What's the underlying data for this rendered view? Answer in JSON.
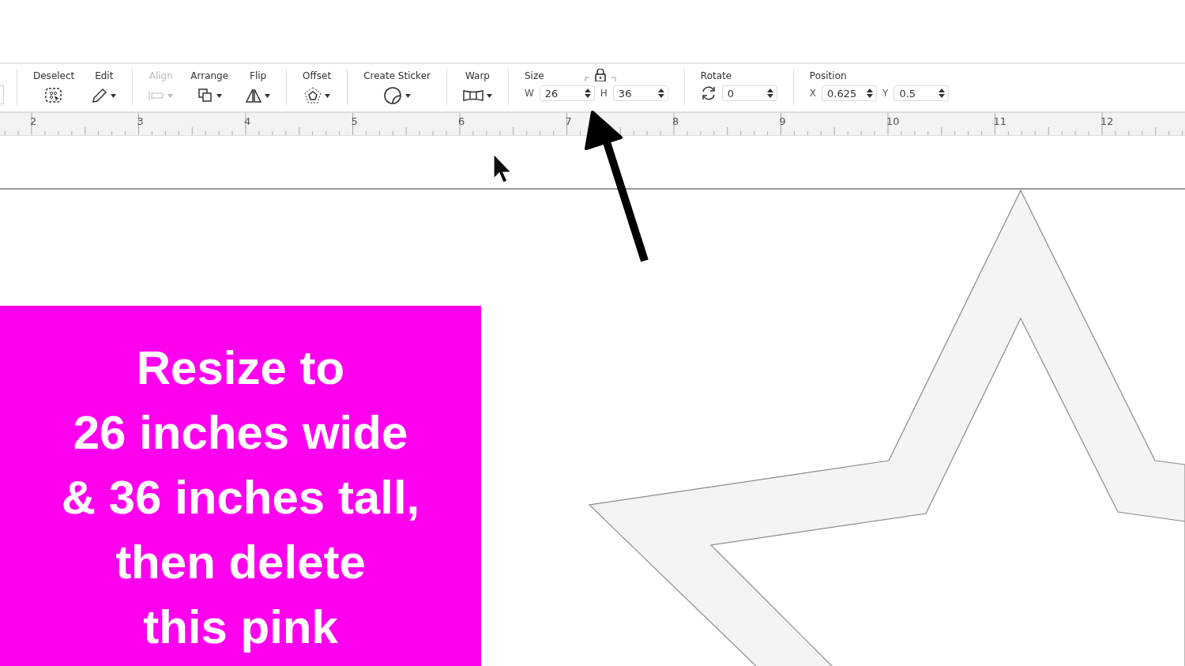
{
  "toolbar": {
    "groups": [
      {
        "tools": [
          {
            "label": "Deselect",
            "kind": "deselect",
            "disabled": false,
            "dropdown": false
          },
          {
            "label": "Edit",
            "kind": "edit",
            "disabled": false,
            "dropdown": true
          }
        ]
      },
      {
        "tools": [
          {
            "label": "Align",
            "kind": "align",
            "disabled": true,
            "dropdown": true
          },
          {
            "label": "Arrange",
            "kind": "arrange",
            "disabled": false,
            "dropdown": true
          },
          {
            "label": "Flip",
            "kind": "flip",
            "disabled": false,
            "dropdown": true
          }
        ]
      },
      {
        "tools": [
          {
            "label": "Offset",
            "kind": "offset",
            "disabled": false,
            "dropdown": true
          }
        ]
      },
      {
        "tools": [
          {
            "label": "Create Sticker",
            "kind": "sticker",
            "disabled": false,
            "dropdown": true
          }
        ]
      },
      {
        "tools": [
          {
            "label": "Warp",
            "kind": "warp",
            "disabled": false,
            "dropdown": true
          }
        ]
      }
    ],
    "size": {
      "label": "Size",
      "locked": true,
      "fields": [
        {
          "axis": "W",
          "value": "26"
        },
        {
          "axis": "H",
          "value": "36"
        }
      ]
    },
    "rotate": {
      "label": "Rotate",
      "value": "0"
    },
    "position": {
      "label": "Position",
      "fields": [
        {
          "axis": "X",
          "value": "0.625"
        },
        {
          "axis": "Y",
          "value": "0.5"
        }
      ]
    }
  },
  "ruler": {
    "labels": [
      "2",
      "3",
      "4",
      "5",
      "6",
      "7",
      "8",
      "9",
      "10",
      "11",
      "12"
    ]
  },
  "overlay": {
    "lines": [
      "Resize to",
      "26 inches wide",
      "& 36 inches tall,",
      "then delete",
      "this pink"
    ]
  }
}
